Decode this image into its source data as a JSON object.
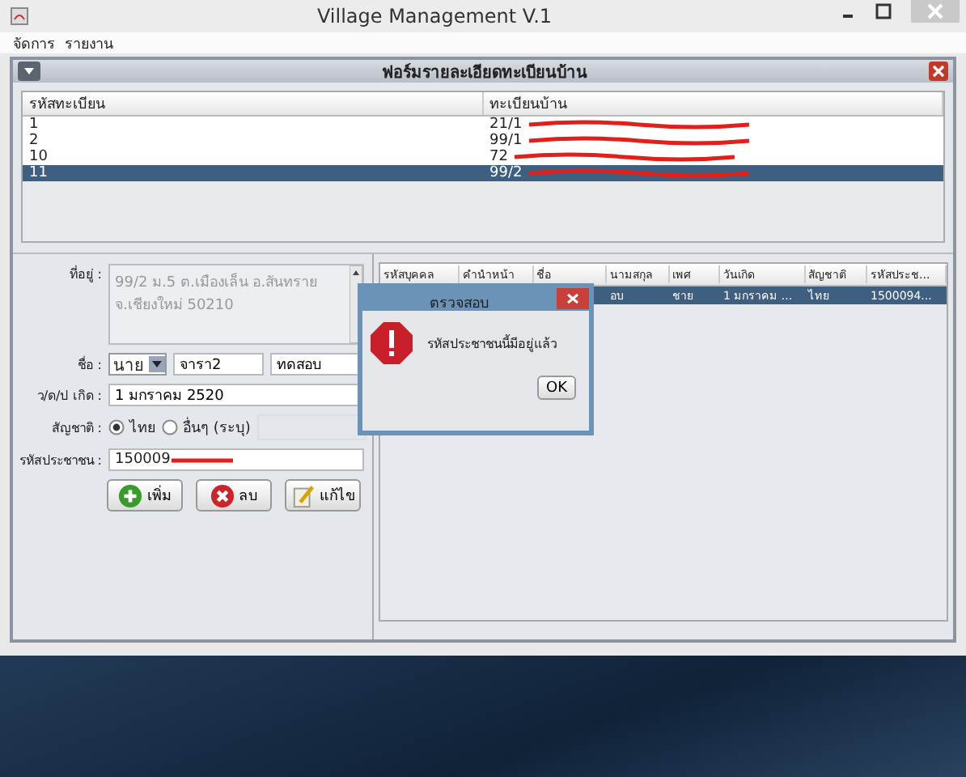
{
  "window": {
    "title": "Village Management V.1"
  },
  "menu": [
    "จัดการ",
    "รายงาน"
  ],
  "frame": {
    "title": "ฟอร์มรายละเอียดทะเบียนบ้าน"
  },
  "house_table": {
    "columns": [
      "รหัสทะเบียน",
      "ทะเบียนบ้าน"
    ],
    "rows": [
      {
        "id": "1",
        "address": "21/1",
        "selected": false
      },
      {
        "id": "2",
        "address": "99/1",
        "selected": false
      },
      {
        "id": "10",
        "address": "72",
        "selected": false
      },
      {
        "id": "11",
        "address": "99/2",
        "selected": true
      }
    ]
  },
  "form": {
    "address_label": "ที่อยู่ :",
    "address": "99/2 ม.5 ต.เมืองเล็น อ.สันทราย จ.เชียงใหม่ 50210",
    "address_disabled": true,
    "name_label": "ชื่อ :",
    "prefix": "นาย",
    "first_name": "จารา2",
    "last_name": "ทดสอบ",
    "birth_label": "ว/ด/ป เกิด :",
    "birth": "1 มกราคม 2520",
    "nationality_label": "สัญชาติ :",
    "nationality_options": [
      {
        "label": "ไทย",
        "selected": true
      },
      {
        "label": "อื่นๆ (ระบุ)",
        "selected": false
      }
    ],
    "id_label": "รหัสประชาชน :",
    "id_value": "150009",
    "buttons": [
      {
        "kind": "add",
        "label": "เพิ่ม"
      },
      {
        "kind": "delete",
        "label": "ลบ"
      },
      {
        "kind": "edit",
        "label": "แก้ไข"
      }
    ]
  },
  "person_table": {
    "columns": [
      "รหัสบุคคล",
      "คำนำหน้า",
      "ชื่อ",
      "นามสกุล",
      "เพศ",
      "วันเกิด",
      "สัญชาติ",
      "รหัสประช..."
    ],
    "rows": [
      {
        "selected": true,
        "cells": [
          null,
          null,
          null,
          "อบ",
          "ชาย",
          "1 มกราคม ...",
          "ไทย",
          "1500094..."
        ]
      }
    ]
  },
  "dialog": {
    "title": "ตรวจสอบ",
    "message": "รหัสประชาชนนี้มีอยู่แล้ว",
    "button": "OK"
  }
}
